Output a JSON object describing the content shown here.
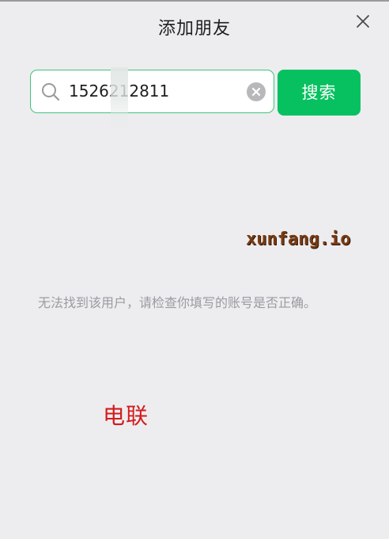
{
  "dialog": {
    "title": "添加朋友",
    "close_icon": "close-icon"
  },
  "search": {
    "value": "1526212811",
    "search_icon": "search-icon",
    "clear_icon": "clear-circle-icon",
    "button_label": "搜索",
    "accent_color": "#07c160",
    "border_color": "#3ec47a"
  },
  "result": {
    "message": "无法找到该用户，请检查你填写的账号是否正确。"
  },
  "overlays": {
    "watermark": "xunfang.io",
    "stamp_text": "电联"
  }
}
